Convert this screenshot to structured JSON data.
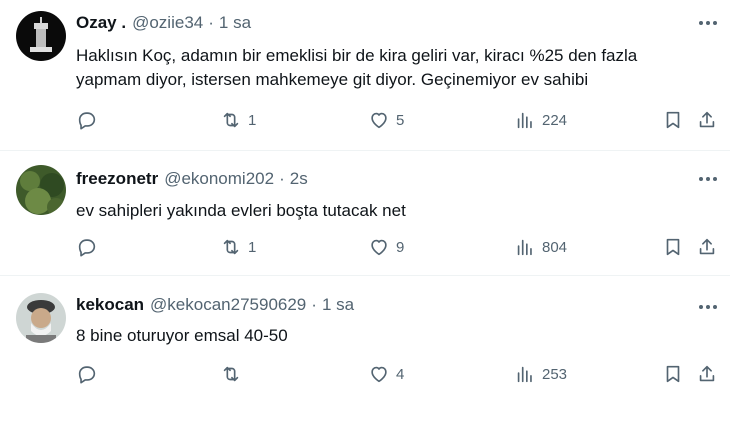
{
  "tweets": [
    {
      "name": "Ozay .",
      "handle": "@oziie34",
      "sep": "·",
      "time": "1 sa",
      "text": "Haklısın Koç, adamın bir emeklisi bir de kira geliri var, kiracı %25 den fazla yapmam diyor, istersen mahkemeye git diyor. Geçinemiyor ev sahibi",
      "retweets": "1",
      "likes": "5",
      "views": "224"
    },
    {
      "name": "freezonetr",
      "handle": "@ekonomi202",
      "sep": "·",
      "time": "2s",
      "text": "ev sahipleri yakında evleri boşta tutacak net",
      "retweets": "1",
      "likes": "9",
      "views": "804"
    },
    {
      "name": "kekocan",
      "handle": "@kekocan27590629",
      "sep": "·",
      "time": "1 sa",
      "text": "8 bine oturuyor emsal 40-50",
      "retweets": "",
      "likes": "4",
      "views": "253"
    }
  ]
}
